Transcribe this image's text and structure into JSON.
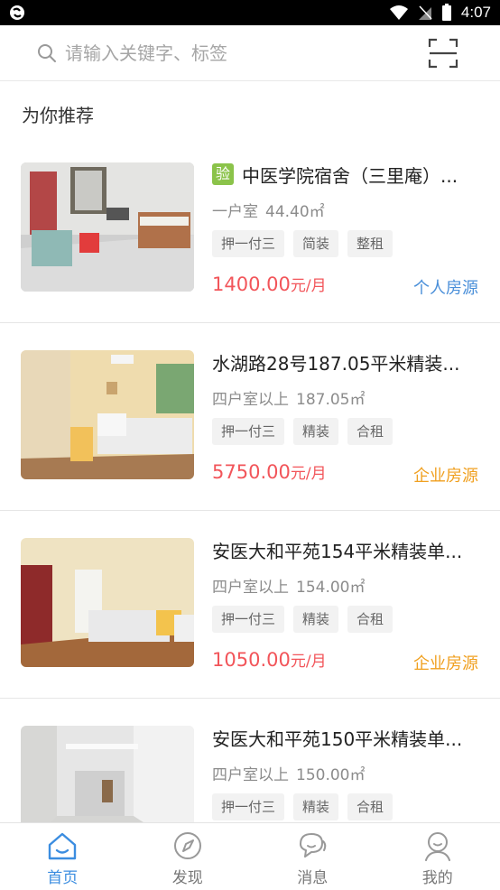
{
  "status_bar": {
    "time": "4:07"
  },
  "search": {
    "placeholder": "请输入关键字、标签"
  },
  "section_title": "为你推荐",
  "listings": [
    {
      "verified_label": "验",
      "title": "中医学院宿舍（三里庵）...",
      "layout": "一户室",
      "area": "44.40㎡",
      "tags": [
        "押一付三",
        "简装",
        "整租"
      ],
      "price": "1400.00",
      "price_unit": "元/月",
      "source": "个人房源"
    },
    {
      "title": "水湖路28号187.05平米精装...",
      "layout": "四户室以上",
      "area": "187.05㎡",
      "tags": [
        "押一付三",
        "精装",
        "合租"
      ],
      "price": "5750.00",
      "price_unit": "元/月",
      "source": "企业房源"
    },
    {
      "title": "安医大和平苑154平米精装单...",
      "layout": "四户室以上",
      "area": "154.00㎡",
      "tags": [
        "押一付三",
        "精装",
        "合租"
      ],
      "price": "1050.00",
      "price_unit": "元/月",
      "source": "企业房源"
    },
    {
      "title": "安医大和平苑150平米精装单...",
      "layout": "四户室以上",
      "area": "150.00㎡",
      "tags": [
        "押一付三",
        "精装",
        "合租"
      ]
    }
  ],
  "bottom_nav": [
    {
      "label": "首页",
      "icon": "home-icon",
      "active": true
    },
    {
      "label": "发现",
      "icon": "compass-icon",
      "active": false
    },
    {
      "label": "消息",
      "icon": "chat-icon",
      "active": false
    },
    {
      "label": "我的",
      "icon": "user-icon",
      "active": false
    }
  ],
  "colors": {
    "price": "#f2555a",
    "personal_source": "#4a8fd9",
    "company_source": "#f0a020",
    "verified_badge": "#8bc34a",
    "nav_active": "#3b8de0"
  }
}
